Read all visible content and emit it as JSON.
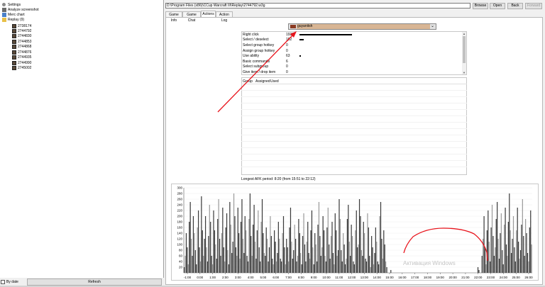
{
  "tree": {
    "items": [
      {
        "label": "Settings",
        "icon": "gear-icon"
      },
      {
        "label": "Analyze screenshot",
        "icon": "camera-icon"
      },
      {
        "label": "Merc chart",
        "icon": "chart-icon"
      },
      {
        "label": "Replay (9)",
        "icon": "folder-icon"
      },
      {
        "label": "2738174",
        "icon": "replay-icon"
      },
      {
        "label": "2744792",
        "icon": "replay-icon"
      },
      {
        "label": "2744830",
        "icon": "replay-icon"
      },
      {
        "label": "2744853",
        "icon": "replay-icon"
      },
      {
        "label": "2744868",
        "icon": "replay-icon"
      },
      {
        "label": "2744876",
        "icon": "replay-icon"
      },
      {
        "label": "2744935",
        "icon": "replay-icon"
      },
      {
        "label": "2744990",
        "icon": "replay-icon"
      },
      {
        "label": "2745002",
        "icon": "replay-icon"
      }
    ],
    "by_date_label": "By date",
    "refresh_label": "Refresh"
  },
  "toolbar": {
    "path": "D:\\Program Files (x86)\\CCup Warcraft III\\Replay\\2744792.w3g",
    "browse": "Browse",
    "open": "Open",
    "back": "Back",
    "forward": "Forward"
  },
  "tabs": [
    "Game Info",
    "Game Chat",
    "Actions",
    "Action Log"
  ],
  "player": {
    "name": "guyanitsh",
    "color": "#8c3b22"
  },
  "stats": [
    {
      "name": "Right click",
      "value": "1922",
      "bar": 1.0
    },
    {
      "name": "Select / deselect",
      "value": "152",
      "bar": 0.08
    },
    {
      "name": "Select group hotkey",
      "value": "0",
      "bar": 0
    },
    {
      "name": "Assign group hotkey",
      "value": "0",
      "bar": 0
    },
    {
      "name": "Use ability",
      "value": "63",
      "bar": 0.03
    },
    {
      "name": "Basic commands",
      "value": "6",
      "bar": 0
    },
    {
      "name": "Select subgroup",
      "value": "0",
      "bar": 0
    },
    {
      "name": "Give item / drop item",
      "value": "0",
      "bar": 0
    }
  ],
  "group_headers": [
    "Group",
    "Assigned",
    "Used"
  ],
  "afk_text": "Longest AFK period: 8:20 (from 15:51 to 22:12)",
  "watermark": "Активация Windows",
  "colors": {
    "annotation_red": "#e8141c",
    "bar_dark": "#3a3a3a",
    "bar_light": "#9a9a9a"
  },
  "chart_data": {
    "type": "bar",
    "ylim": [
      0,
      300
    ],
    "yticks": [
      20,
      40,
      60,
      80,
      100,
      120,
      140,
      160,
      180,
      200,
      220,
      240,
      260,
      280,
      300
    ],
    "xticks": [
      "-1:00",
      "0:00",
      "1:00",
      "2:00",
      "3:00",
      "4:00",
      "5:00",
      "6:00",
      "7:00",
      "8:00",
      "9:00",
      "10:00",
      "11:00",
      "12:00",
      "13:00",
      "14:00",
      "15:00",
      "16:00",
      "17:00",
      "18:00",
      "19:00",
      "20:00",
      "21:00",
      "22:00",
      "23:00",
      "24:00",
      "25:00",
      "26:00"
    ],
    "values": [
      20,
      60,
      140,
      90,
      30,
      180,
      250,
      120,
      60,
      200,
      140,
      80,
      30,
      160,
      220,
      90,
      40,
      270,
      150,
      60,
      120,
      200,
      90,
      40,
      130,
      240,
      180,
      60,
      30,
      220,
      150,
      100,
      50,
      190,
      260,
      120,
      60,
      140,
      230,
      90,
      40,
      160,
      210,
      80,
      30,
      250,
      170,
      70,
      110,
      280,
      200,
      90,
      60,
      230,
      140,
      50,
      180,
      260,
      120,
      70,
      200,
      150,
      60,
      40,
      190,
      280,
      130,
      60,
      170,
      240,
      110,
      50,
      150,
      220,
      90,
      40,
      180,
      260,
      140,
      70,
      60,
      160,
      120,
      40,
      90,
      200,
      130,
      50,
      30,
      150,
      110,
      40,
      70,
      180,
      120,
      50,
      40,
      140,
      200,
      90,
      30,
      120,
      90,
      40,
      160,
      230,
      110,
      50,
      80,
      170,
      120,
      40,
      60,
      190,
      140,
      70,
      30,
      130,
      210,
      100,
      40,
      110,
      180,
      70,
      50,
      150,
      220,
      90,
      30,
      140,
      100,
      40,
      170,
      250,
      130,
      60,
      90,
      200,
      150,
      60,
      40,
      160,
      230,
      100,
      50,
      130,
      180,
      70,
      30,
      210,
      150,
      60,
      80,
      260,
      190,
      80,
      40,
      140,
      100,
      30,
      50,
      190,
      240,
      110,
      60,
      170,
      130,
      40,
      30,
      150,
      220,
      90,
      100,
      260,
      200,
      80,
      60,
      180,
      140,
      50,
      40,
      210,
      160,
      60,
      20,
      130,
      90,
      30,
      70,
      160,
      110,
      40,
      30,
      200,
      250,
      120,
      50,
      150,
      100,
      40,
      20,
      0,
      0,
      0,
      10,
      0,
      0,
      0,
      0,
      0,
      0,
      0,
      0,
      0,
      0,
      0,
      0,
      0,
      0,
      0,
      0,
      0,
      0,
      0,
      0,
      0,
      0,
      0,
      0,
      0,
      0,
      0,
      0,
      0,
      0,
      0,
      0,
      0,
      0,
      0,
      0,
      0,
      0,
      0,
      0,
      0,
      0,
      0,
      0,
      0,
      0,
      0,
      0,
      0,
      0,
      0,
      0,
      0,
      0,
      0,
      0,
      0,
      0,
      0,
      0,
      0,
      0,
      0,
      0,
      0,
      0,
      0,
      0,
      0,
      0,
      0,
      0,
      0,
      0,
      0,
      0,
      0,
      0,
      0,
      0,
      0,
      0,
      0,
      0,
      0,
      20,
      10,
      0,
      0,
      60,
      120,
      200,
      90,
      30,
      150,
      220,
      110,
      40,
      160,
      240,
      130,
      60,
      90,
      190,
      250,
      120,
      50,
      140,
      210,
      80,
      30,
      170,
      230,
      100,
      60,
      180,
      280,
      150,
      70,
      120,
      200,
      90,
      40,
      150,
      230,
      110,
      50,
      80,
      170,
      260,
      130,
      60,
      190,
      140,
      70,
      40,
      160,
      220,
      100
    ]
  }
}
